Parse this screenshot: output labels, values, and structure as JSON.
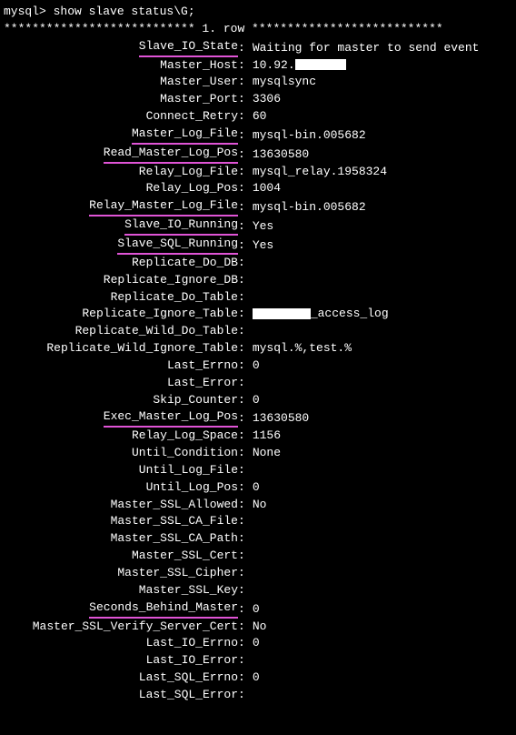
{
  "prompt": "mysql> show slave status\\G;",
  "separator": "*************************** 1. row ***************************",
  "rows": [
    {
      "label": "Slave_IO_State",
      "value": "Waiting for master to send event",
      "underlined": true
    },
    {
      "label": "Master_Host",
      "value": "10.92.",
      "underlined": false,
      "redact_after": true,
      "redact_width": "w60"
    },
    {
      "label": "Master_User",
      "value": "mysqlsync",
      "underlined": false
    },
    {
      "label": "Master_Port",
      "value": "3306",
      "underlined": false
    },
    {
      "label": "Connect_Retry",
      "value": "60",
      "underlined": false
    },
    {
      "label": "Master_Log_File",
      "value": "mysql-bin.005682",
      "underlined": true
    },
    {
      "label": "Read_Master_Log_Pos",
      "value": "13630580",
      "underlined": true
    },
    {
      "label": "Relay_Log_File",
      "value": "mysql_relay.1958324",
      "underlined": false
    },
    {
      "label": "Relay_Log_Pos",
      "value": "1004",
      "underlined": false
    },
    {
      "label": "Relay_Master_Log_File",
      "value": "mysql-bin.005682",
      "underlined": true
    },
    {
      "label": "Slave_IO_Running",
      "value": "Yes",
      "underlined": true
    },
    {
      "label": "Slave_SQL_Running",
      "value": "Yes",
      "underlined": true
    },
    {
      "label": "Replicate_Do_DB",
      "value": "",
      "underlined": false
    },
    {
      "label": "Replicate_Ignore_DB",
      "value": "",
      "underlined": false
    },
    {
      "label": "Replicate_Do_Table",
      "value": "",
      "underlined": false
    },
    {
      "label": "Replicate_Ignore_Table",
      "value": "_access_log",
      "underlined": false,
      "redact_before": true,
      "redact_width": "w64"
    },
    {
      "label": "Replicate_Wild_Do_Table",
      "value": "",
      "underlined": false
    },
    {
      "label": "Replicate_Wild_Ignore_Table",
      "value": "mysql.%,test.%",
      "underlined": false
    },
    {
      "label": "Last_Errno",
      "value": "0",
      "underlined": false
    },
    {
      "label": "Last_Error",
      "value": "",
      "underlined": false
    },
    {
      "label": "Skip_Counter",
      "value": "0",
      "underlined": false
    },
    {
      "label": "Exec_Master_Log_Pos",
      "value": "13630580",
      "underlined": true
    },
    {
      "label": "Relay_Log_Space",
      "value": "1156",
      "underlined": false
    },
    {
      "label": "Until_Condition",
      "value": "None",
      "underlined": false
    },
    {
      "label": "Until_Log_File",
      "value": "",
      "underlined": false
    },
    {
      "label": "Until_Log_Pos",
      "value": "0",
      "underlined": false
    },
    {
      "label": "Master_SSL_Allowed",
      "value": "No",
      "underlined": false
    },
    {
      "label": "Master_SSL_CA_File",
      "value": "",
      "underlined": false
    },
    {
      "label": "Master_SSL_CA_Path",
      "value": "",
      "underlined": false
    },
    {
      "label": "Master_SSL_Cert",
      "value": "",
      "underlined": false
    },
    {
      "label": "Master_SSL_Cipher",
      "value": "",
      "underlined": false
    },
    {
      "label": "Master_SSL_Key",
      "value": "",
      "underlined": false
    },
    {
      "label": "Seconds_Behind_Master",
      "value": "0",
      "underlined": true
    },
    {
      "label": "Master_SSL_Verify_Server_Cert",
      "value": "No",
      "underlined": false
    },
    {
      "label": "Last_IO_Errno",
      "value": "0",
      "underlined": false
    },
    {
      "label": "Last_IO_Error",
      "value": "",
      "underlined": false
    },
    {
      "label": "Last_SQL_Errno",
      "value": "0",
      "underlined": false
    },
    {
      "label": "Last_SQL_Error",
      "value": "",
      "underlined": false
    }
  ]
}
